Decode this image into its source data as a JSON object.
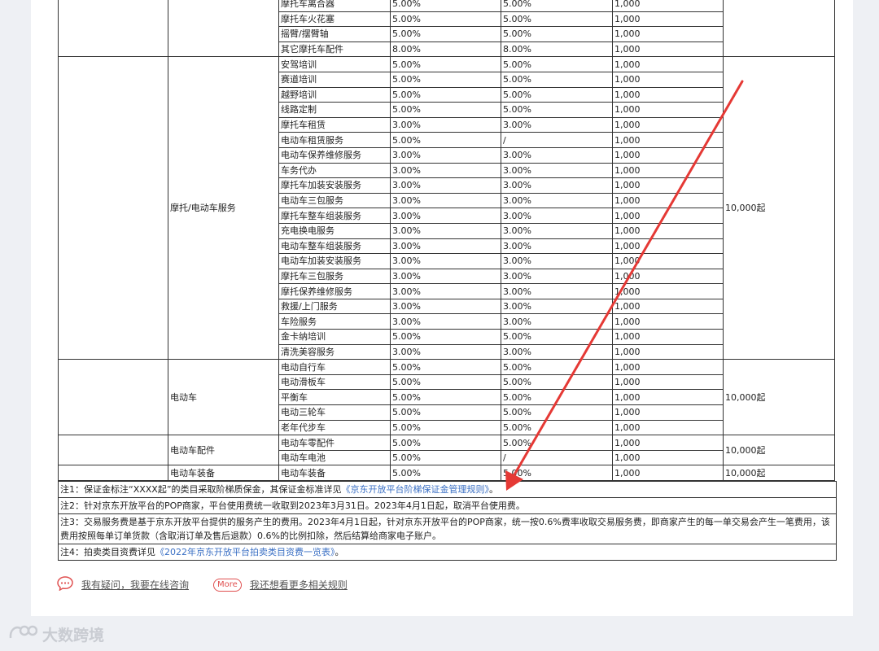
{
  "table": {
    "blocks": [
      {
        "category": "",
        "deposit": "",
        "rows": [
          [
            "摩托车离合器",
            "5.00%",
            "5.00%",
            "1,000"
          ],
          [
            "摩托车火花塞",
            "5.00%",
            "5.00%",
            "1,000"
          ],
          [
            "摇臂/摆臂轴",
            "5.00%",
            "5.00%",
            "1,000"
          ],
          [
            "其它摩托车配件",
            "8.00%",
            "8.00%",
            "1,000"
          ]
        ]
      },
      {
        "category": "摩托/电动车服务",
        "deposit": "10,000起",
        "rows": [
          [
            "安驾培训",
            "5.00%",
            "5.00%",
            "1,000"
          ],
          [
            "赛道培训",
            "5.00%",
            "5.00%",
            "1,000"
          ],
          [
            "越野培训",
            "5.00%",
            "5.00%",
            "1,000"
          ],
          [
            "线路定制",
            "5.00%",
            "5.00%",
            "1,000"
          ],
          [
            "摩托车租赁",
            "3.00%",
            "3.00%",
            "1,000"
          ],
          [
            "电动车租赁服务",
            "5.00%",
            "/",
            "1,000"
          ],
          [
            "电动车保养维修服务",
            "3.00%",
            "3.00%",
            "1,000"
          ],
          [
            "车务代办",
            "3.00%",
            "3.00%",
            "1,000"
          ],
          [
            "摩托车加装安装服务",
            "3.00%",
            "3.00%",
            "1,000"
          ],
          [
            "电动车三包服务",
            "3.00%",
            "3.00%",
            "1,000"
          ],
          [
            "摩托车整车组装服务",
            "3.00%",
            "3.00%",
            "1,000"
          ],
          [
            "充电换电服务",
            "3.00%",
            "3.00%",
            "1,000"
          ],
          [
            "电动车整车组装服务",
            "3.00%",
            "3.00%",
            "1,000"
          ],
          [
            "电动车加装安装服务",
            "3.00%",
            "3.00%",
            "1,000"
          ],
          [
            "摩托车三包服务",
            "3.00%",
            "3.00%",
            "1,000"
          ],
          [
            "摩托保养维修服务",
            "3.00%",
            "3.00%",
            "1,000"
          ],
          [
            "救援/上门服务",
            "3.00%",
            "3.00%",
            "1,000"
          ],
          [
            "车险服务",
            "3.00%",
            "3.00%",
            "1,000"
          ],
          [
            "金卡纳培训",
            "5.00%",
            "5.00%",
            "1,000"
          ],
          [
            "清洗美容服务",
            "3.00%",
            "3.00%",
            "1,000"
          ]
        ]
      },
      {
        "category": "电动车",
        "deposit": "10,000起",
        "rows": [
          [
            "电动自行车",
            "5.00%",
            "5.00%",
            "1,000"
          ],
          [
            "电动滑板车",
            "5.00%",
            "5.00%",
            "1,000"
          ],
          [
            "平衡车",
            "5.00%",
            "5.00%",
            "1,000"
          ],
          [
            "电动三轮车",
            "5.00%",
            "5.00%",
            "1,000"
          ],
          [
            "老年代步车",
            "5.00%",
            "5.00%",
            "1,000"
          ]
        ]
      },
      {
        "category": "电动车配件",
        "deposit": "10,000起",
        "rows": [
          [
            "电动车零配件",
            "5.00%",
            "5.00%",
            "1,000"
          ],
          [
            "电动车电池",
            "5.00%",
            "/",
            "1,000"
          ]
        ]
      },
      {
        "category": "电动车装备",
        "deposit": "10,000起",
        "rows": [
          [
            "电动车装备",
            "5.00%",
            "5.00%",
            "1,000"
          ]
        ]
      }
    ]
  },
  "notes": {
    "n1_pre": "注1：保证金标注“XXXX起”的类目采取阶梯质保金，其保证金标准详见",
    "n1_link": "《京东开放平台阶梯保证金管理规则》",
    "n1_post": "。",
    "n2": "注2：针对京东开放平台的POP商家，平台使用费统一收取到2023年3月31日。2023年4月1日起，取消平台使用费。",
    "n3": "注3：交易服务费是基于京东开放平台提供的服务产生的费用。2023年4月1日起，针对京东开放平台的POP商家，统一按0.6%费率收取交易服务费，即商家产生的每一单交易会产生一笔费用，该费用按照每单订单货款（含取消订单及售后退款）0.6%的比例扣除，然后结算给商家电子账户。",
    "n4_pre": "注4：拍卖类目资费详见",
    "n4_link": "《2022年京东开放平台拍卖类目资费一览表》",
    "n4_post": "。"
  },
  "footer": {
    "consult_label": "我有疑问，我要在线咨询",
    "more_badge": "More",
    "more_label": "我还想看更多相关规则"
  },
  "watermark": "大数跨境",
  "colors": {
    "arrow": "#e53935",
    "link": "#3a6fc4"
  }
}
